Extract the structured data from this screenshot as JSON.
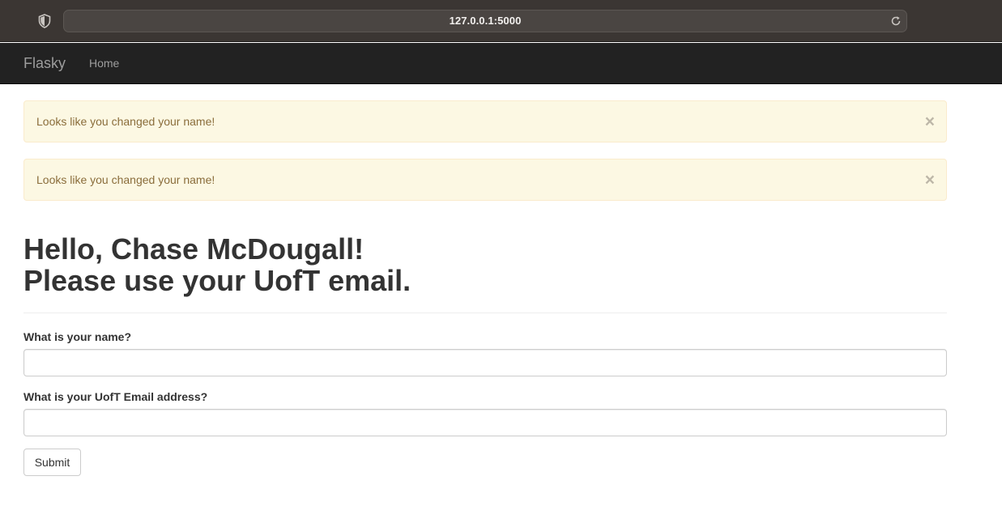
{
  "browser": {
    "url": "127.0.0.1:5000"
  },
  "navbar": {
    "brand": "Flasky",
    "items": [
      {
        "label": "Home"
      }
    ]
  },
  "alerts": [
    {
      "message": "Looks like you changed your name!",
      "close": "×"
    },
    {
      "message": "Looks like you changed your name!",
      "close": "×"
    }
  ],
  "header": {
    "line1": "Hello, Chase McDougall!",
    "line2": "Please use your UofT email."
  },
  "form": {
    "name_label": "What is your name?",
    "name_value": "",
    "email_label": "What is your UofT Email address?",
    "email_value": "",
    "submit_label": "Submit"
  }
}
